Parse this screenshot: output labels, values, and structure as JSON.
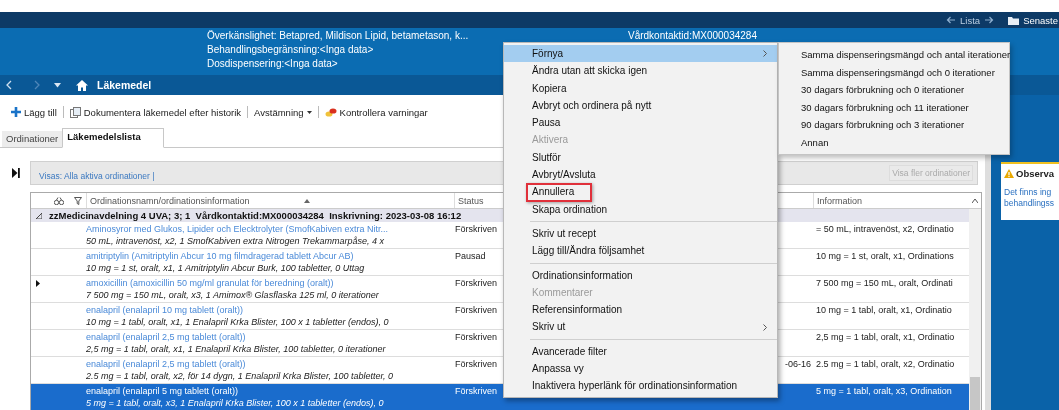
{
  "top_bar": {
    "history_label": "Lista",
    "recent_label": "Senaste"
  },
  "patient_header": {
    "lines": [
      "Överkänslighet: Betapred, Mildison Lipid, betametason, k...",
      "Behandlingsbegränsning:<Inga data>",
      "Dosdispensering:<Inga data>"
    ],
    "contact": "Vårdkontaktid:MX000034284"
  },
  "nav": {
    "title": "Läkemedel"
  },
  "toolbar": [
    {
      "kind": "add",
      "label": "Lägg till"
    },
    {
      "kind": "document",
      "label": "Dokumentera läkemedel efter historik"
    },
    {
      "kind": "dropdown",
      "label": "Avstämning"
    },
    {
      "kind": "warnings",
      "label": "Kontrollera varningar"
    }
  ],
  "tabs": [
    {
      "label": "Ordinationer",
      "selected": false
    },
    {
      "label": "Läkemedelslista",
      "selected": true
    }
  ],
  "filter": {
    "label": "Visas: Alla aktiva ordinationer |",
    "more_button": {
      "label": "Visa fler ordinationer",
      "disabled": true
    }
  },
  "table": {
    "columns": [
      {
        "label": "Ordinationsnamn/ordinationsinformation",
        "sorted": true
      },
      {
        "label": "Status",
        "sorted": false
      },
      {
        "label": "Information",
        "sorted": false
      }
    ],
    "group": {
      "label": "zzMedicinavdelning 4 UVA; 3; 1  Vårdkontaktid:MX000034284  Inskrivning: 2023-03-08 16:12",
      "expanded": true
    },
    "rows": [
      {
        "name": "Aminosyror med Glukos, Lipider och Elecktrolyter (SmofKabiven extra Nitr...",
        "detail": "50 mL, intravenöst, x2, 1 SmofKabiven extra Nitrogen Trekammarpåse, 4 x",
        "status": "Förskriven",
        "information": "= 50 mL, intravenöst, x2, Ordinatio",
        "current": false,
        "selected": false
      },
      {
        "name": "amitriptylin (Amitriptylin Abcur 10 mg filmdragerad tablett Abcur AB)",
        "detail": "10 mg = 1 st, oralt, x1, 1 Amitriptylin Abcur Burk, 100 tabletter, 0 Uttag",
        "status": "Pausad",
        "information": "10 mg = 1 st, oralt, x1, Ordinations",
        "current": false,
        "selected": false
      },
      {
        "name": "amoxicillin (amoxicillin 50 mg/ml granulat för beredning (oralt))",
        "detail": "7 500 mg = 150 mL, oralt, x3, 1 Amimox® Glasflaska 125 ml, 0 iterationer",
        "status": "Förskriven",
        "information": "7 500 mg = 150 mL, oralt, Ordinati",
        "current": true,
        "selected": false
      },
      {
        "name": "enalapril (enalapril 10 mg tablett (oralt))",
        "detail": "10 mg = 1 tabl, oralt, x1, 1 Enalapril Krka Blister, 100 x 1 tabletter (endos), 0",
        "status": "Förskriven",
        "information": "10 mg = 1 tabl, oralt, x1, Ordinatio",
        "current": false,
        "selected": false
      },
      {
        "name": "enalapril (enalapril 2,5 mg tablett (oralt))",
        "detail": "2,5 mg = 1 tabl, oralt, x1, 1 Enalapril Krka Blister, 100 tabletter, 0 iterationer",
        "status": "Förskriven",
        "information": "2,5 mg = 1 tabl, oralt, x1, Ordinatio",
        "current": false,
        "selected": false
      },
      {
        "name": "enalapril (enalapril 2,5 mg tablett (oralt))",
        "detail": "2.5 mg = 1 tabl, oralt, x2, för 14 dygn, 1 Enalapril Krka Blister, 100 tabletter, 0",
        "status": "Förskriven",
        "column_4": "-06-16",
        "information": "2.5 mg = 1 tabl, oralt, x2, Ordinatio",
        "current": false,
        "selected": false
      },
      {
        "name": "enalapril (enalapril 5 mg tablett (oralt))",
        "detail": "5 mg = 1 tabl, oralt, x3, 1 Enalapril Krka Blister, 100 x 1 tabletter (endos), 0",
        "status": "Förskriven",
        "information": "5 mg = 1 tabl, oralt, x3, Ordination",
        "current": false,
        "selected": true
      }
    ]
  },
  "context_menu": {
    "groups": [
      [
        {
          "label": "Förnya",
          "selected": true,
          "disabled": false,
          "submenu": true,
          "marked": false
        },
        {
          "label": "Ändra utan att skicka igen",
          "selected": false,
          "disabled": false,
          "submenu": false,
          "marked": false
        },
        {
          "label": "Kopiera",
          "selected": false,
          "disabled": false,
          "submenu": false,
          "marked": false
        },
        {
          "label": "Avbryt och ordinera på nytt",
          "selected": false,
          "disabled": false,
          "submenu": false,
          "marked": false
        },
        {
          "label": "Pausa",
          "selected": false,
          "disabled": false,
          "submenu": false,
          "marked": false
        },
        {
          "label": "Aktivera",
          "selected": false,
          "disabled": true,
          "submenu": false,
          "marked": false
        },
        {
          "label": "Slutför",
          "selected": false,
          "disabled": false,
          "submenu": false,
          "marked": false
        },
        {
          "label": "Avbryt/Avsluta",
          "selected": false,
          "disabled": false,
          "submenu": false,
          "marked": false
        },
        {
          "label": "Annullera",
          "selected": false,
          "disabled": false,
          "submenu": false,
          "marked": true
        },
        {
          "label": "Skapa ordination",
          "selected": false,
          "disabled": false,
          "submenu": false,
          "marked": false
        }
      ],
      [
        {
          "label": "Skriv ut recept",
          "selected": false,
          "disabled": false,
          "submenu": false,
          "marked": false
        },
        {
          "label": "Lägg till/Ändra följsamhet",
          "selected": false,
          "disabled": false,
          "submenu": false,
          "marked": false
        }
      ],
      [
        {
          "label": "Ordinationsinformation",
          "selected": false,
          "disabled": false,
          "submenu": false,
          "marked": false
        },
        {
          "label": "Kommentarer",
          "selected": false,
          "disabled": true,
          "submenu": false,
          "marked": false
        },
        {
          "label": "Referensinformation",
          "selected": false,
          "disabled": false,
          "submenu": false,
          "marked": false
        },
        {
          "label": "Skriv ut",
          "selected": false,
          "disabled": false,
          "submenu": true,
          "marked": false
        }
      ],
      [
        {
          "label": "Avancerade filter",
          "selected": false,
          "disabled": false,
          "submenu": false,
          "marked": false
        },
        {
          "label": "Anpassa vy",
          "selected": false,
          "disabled": false,
          "submenu": false,
          "marked": false
        },
        {
          "label": "Inaktivera hyperlänk för ordinationsinformation",
          "selected": false,
          "disabled": false,
          "submenu": false,
          "marked": false
        }
      ]
    ]
  },
  "submenu": {
    "items": [
      "Samma dispenseringsmängd och antal iterationer",
      "Samma dispenseringsmängd och 0 iterationer",
      "30 dagars förbrukning och 0 iterationer",
      "30 dagars förbrukning och 11 iterationer",
      "90 dagars förbrukning och 3 iterationer",
      "Annan"
    ]
  },
  "side_panel": {
    "card": {
      "title": "Observa",
      "text_lines": [
        "Det finns ing",
        "behandlingss"
      ]
    }
  }
}
